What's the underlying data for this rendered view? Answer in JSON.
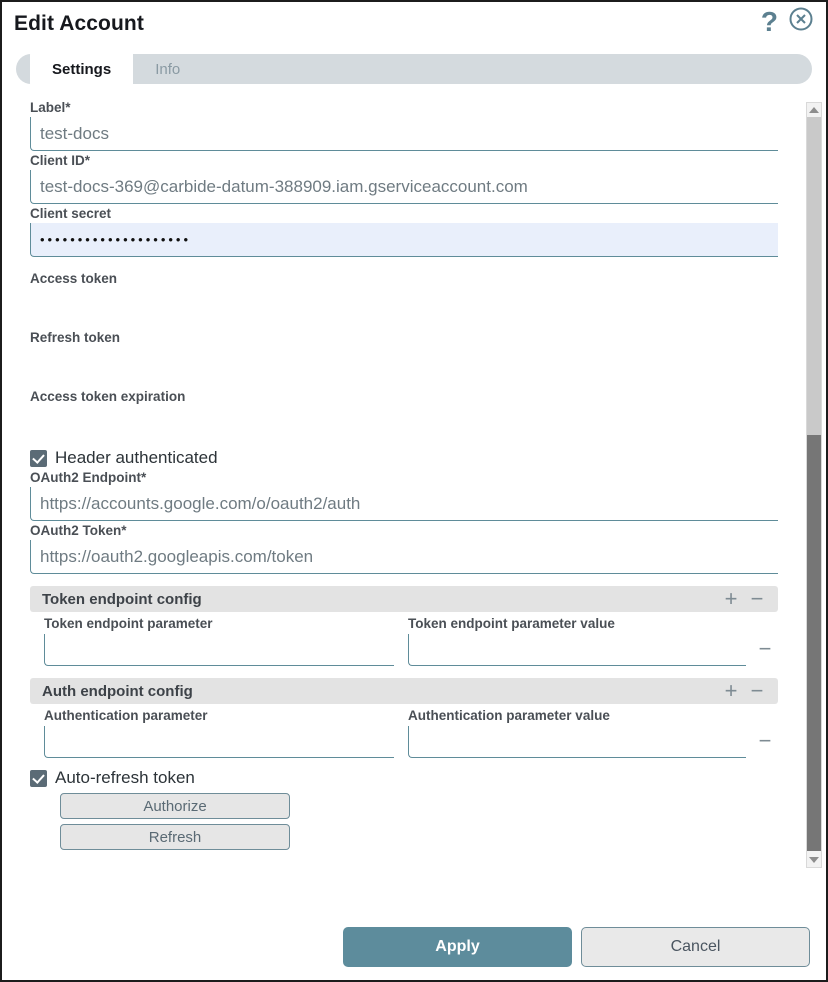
{
  "window": {
    "title": "Edit Account",
    "help_icon": "question-mark-icon",
    "close_icon": "close-circle-icon"
  },
  "tabs": [
    {
      "label": "Settings",
      "active": true
    },
    {
      "label": "Info",
      "active": false
    }
  ],
  "form": {
    "label_field": {
      "label": "Label*",
      "value": "test-docs"
    },
    "client_id": {
      "label": "Client ID*",
      "value": "test-docs-369@carbide-datum-388909.iam.gserviceaccount.com"
    },
    "client_secret": {
      "label": "Client secret",
      "value": "••••••••••••••••••••"
    },
    "access_token": {
      "label": "Access token",
      "value": ""
    },
    "refresh_token": {
      "label": "Refresh token",
      "value": ""
    },
    "access_token_expiration": {
      "label": "Access token expiration",
      "value": ""
    },
    "header_authenticated": {
      "label": "Header authenticated",
      "checked": true
    },
    "oauth2_endpoint": {
      "label": "OAuth2 Endpoint*",
      "value": "https://accounts.google.com/o/oauth2/auth"
    },
    "oauth2_token": {
      "label": "OAuth2 Token*",
      "value": "https://oauth2.googleapis.com/token"
    },
    "auto_refresh_token": {
      "label": "Auto-refresh token",
      "checked": true
    }
  },
  "token_endpoint_config": {
    "title": "Token endpoint config",
    "add_label": "+",
    "remove_label": "−",
    "param_label": "Token endpoint parameter",
    "param_value": "",
    "value_label": "Token endpoint parameter value",
    "value_value": "",
    "row_remove_label": "−"
  },
  "auth_endpoint_config": {
    "title": "Auth endpoint config",
    "add_label": "+",
    "remove_label": "−",
    "param_label": "Authentication parameter",
    "param_value": "",
    "value_label": "Authentication parameter value",
    "value_value": "",
    "row_remove_label": "−"
  },
  "buttons": {
    "authorize": "Authorize",
    "refresh": "Refresh",
    "apply": "Apply",
    "cancel": "Cancel"
  },
  "colors": {
    "accent": "#5d8c9c",
    "input_underline": "#5f8c99",
    "checkbox_fill": "#5b6b76",
    "section_header_bg": "#e3e3e3",
    "tabstrip_bg": "#d4dade",
    "secret_field_bg": "#e9effb",
    "scrollbar_thumb": "#767676"
  }
}
